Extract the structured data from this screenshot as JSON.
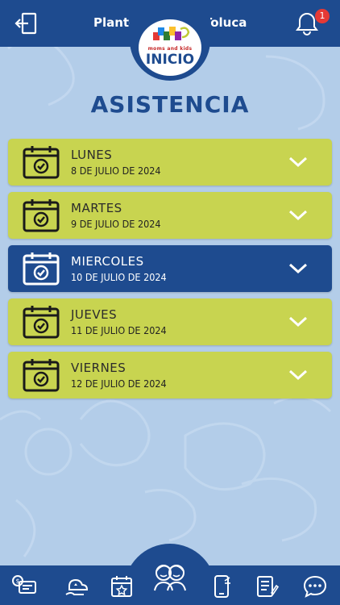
{
  "header": {
    "campus_label": "Plantel",
    "campus_value": "Toluca",
    "notification_count": "1"
  },
  "logo": {
    "brand_text": "moms and kids",
    "button_label": "INICIO"
  },
  "page_title": "ASISTENCIA",
  "days": [
    {
      "name": "LUNES",
      "date": "8 DE JULIO DE 2024",
      "expanded": false
    },
    {
      "name": "MARTES",
      "date": "9 DE JULIO DE 2024",
      "expanded": false
    },
    {
      "name": "MIERCOLES",
      "date": "10 DE JULIO DE 2024",
      "expanded": false,
      "selected": true
    },
    {
      "name": "JUEVES",
      "date": "11 DE JULIO DE 2024",
      "expanded": false
    },
    {
      "name": "VIERNES",
      "date": "12 DE JULIO DE 2024",
      "expanded": false
    }
  ],
  "bottom_nav": {
    "items": [
      "payments-icon",
      "cloud-hand-icon",
      "calendar-star-icon",
      "kids-icon",
      "phone-icon",
      "document-icon",
      "chat-icon"
    ]
  },
  "colors": {
    "primary": "#1e4b8f",
    "card": "#c8d450",
    "background": "#b3cde9",
    "badge": "#e53935"
  }
}
